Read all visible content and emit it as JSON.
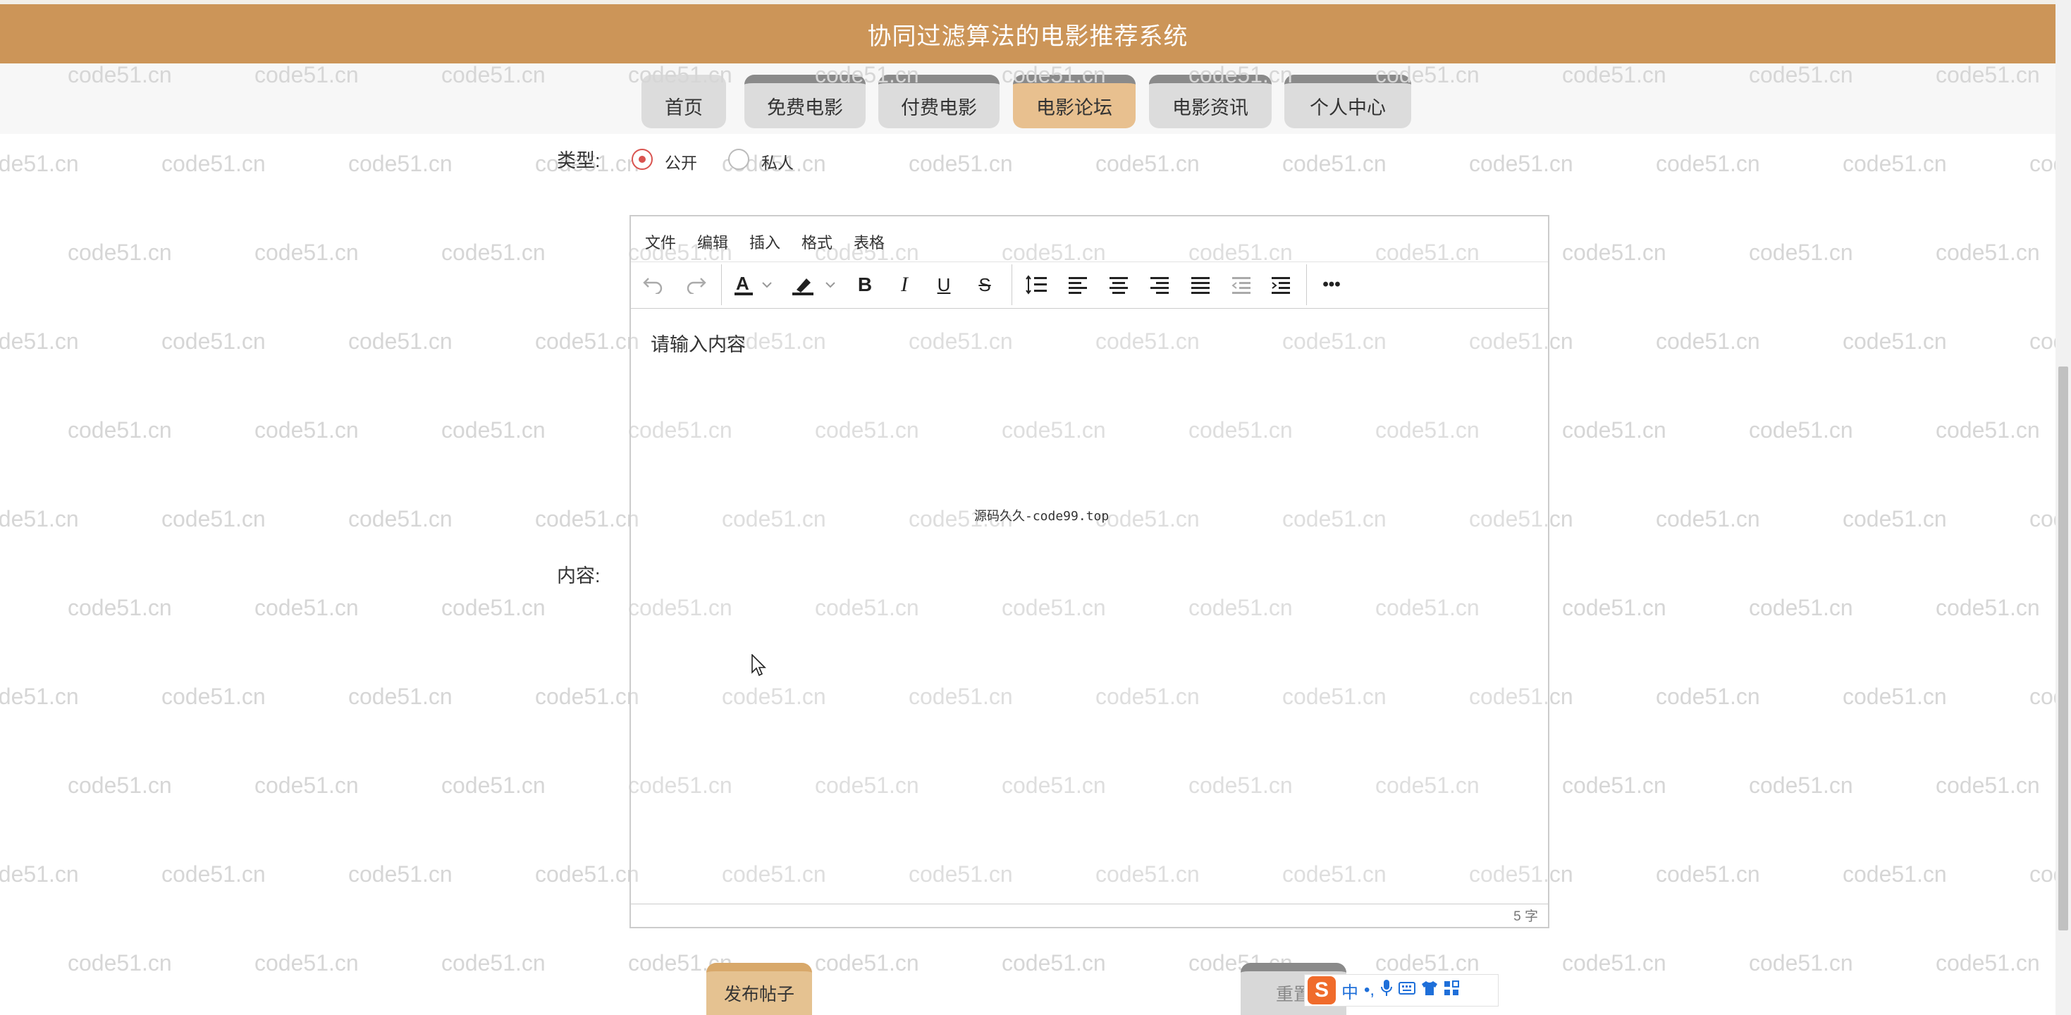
{
  "header": {
    "title": "协同过滤算法的电影推荐系统"
  },
  "nav": {
    "items": [
      {
        "label": "首页",
        "active": false
      },
      {
        "label": "免费电影",
        "active": false
      },
      {
        "label": "付费电影",
        "active": false
      },
      {
        "label": "电影论坛",
        "active": true
      },
      {
        "label": "电影资讯",
        "active": false
      },
      {
        "label": "个人中心",
        "active": false
      }
    ]
  },
  "watermark": {
    "text": "code51.cn"
  },
  "form": {
    "type_label": "类型:",
    "type_options": [
      {
        "label": "公开",
        "checked": true
      },
      {
        "label": "私人",
        "checked": false
      }
    ],
    "content_label": "内容:"
  },
  "editor": {
    "menu": [
      "文件",
      "编辑",
      "插入",
      "格式",
      "表格"
    ],
    "toolbar": {
      "undo": "undo-icon",
      "redo": "redo-icon",
      "font_color": "font-color-icon",
      "highlight": "highlight-icon",
      "bold": "B",
      "italic": "I",
      "underline": "U",
      "strike": "S",
      "more": "•••"
    },
    "placeholder": "请输入内容",
    "word_count": "5 字",
    "overlay": "源码久久-code99.top"
  },
  "buttons": {
    "submit": "发布帖子",
    "reset": "重置"
  },
  "ime": {
    "logo": "S",
    "items": [
      "中",
      "•,",
      "🎤",
      "⌨",
      "👕",
      "▦"
    ]
  },
  "colors": {
    "header_bg": "#cc9558",
    "nav_active": "#e8c08f",
    "nav_default": "#dcdcdc",
    "radio_checked": "#d9534f"
  }
}
